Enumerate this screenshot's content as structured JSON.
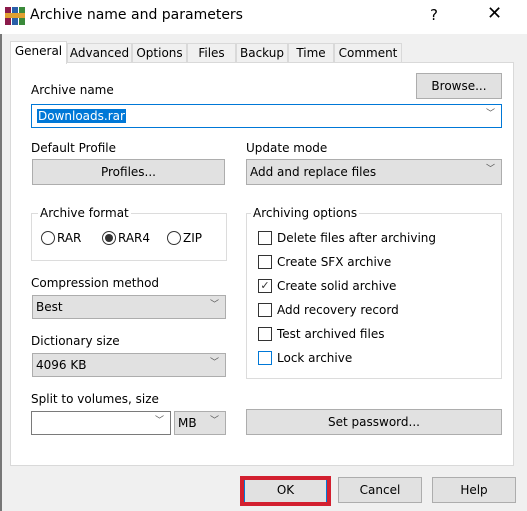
{
  "window": {
    "title": "Archive name and parameters",
    "help_label": "?",
    "close_label": "✕",
    "icon": "winrar-icon"
  },
  "tabs": [
    {
      "label": "General",
      "active": true
    },
    {
      "label": "Advanced"
    },
    {
      "label": "Options"
    },
    {
      "label": "Files"
    },
    {
      "label": "Backup"
    },
    {
      "label": "Time"
    },
    {
      "label": "Comment"
    }
  ],
  "general": {
    "archive_name_label": "Archive name",
    "browse_label": "Browse...",
    "archive_name_value": "Downloads.rar",
    "default_profile_label": "Default Profile",
    "profiles_label": "Profiles...",
    "update_mode_label": "Update mode",
    "update_mode_value": "Add and replace files",
    "archive_format": {
      "title": "Archive format",
      "options": [
        "RAR",
        "RAR4",
        "ZIP"
      ],
      "selected": "RAR4"
    },
    "compression_method_label": "Compression method",
    "compression_method_value": "Best",
    "dictionary_size_label": "Dictionary size",
    "dictionary_size_value": "4096 KB",
    "split_label": "Split to volumes, size",
    "split_value": "",
    "split_unit": "MB",
    "archiving_options": {
      "title": "Archiving options",
      "items": [
        {
          "label": "Delete files after archiving",
          "checked": false
        },
        {
          "label": "Create SFX archive",
          "checked": false
        },
        {
          "label": "Create solid archive",
          "checked": true
        },
        {
          "label": "Add recovery record",
          "checked": false
        },
        {
          "label": "Test archived files",
          "checked": false
        },
        {
          "label": "Lock archive",
          "checked": false
        }
      ]
    },
    "set_password_label": "Set password..."
  },
  "footer": {
    "ok_label": "OK",
    "cancel_label": "Cancel",
    "help_label": "Help"
  },
  "colors": {
    "highlight": "#d32030",
    "accent": "#0078d7"
  }
}
